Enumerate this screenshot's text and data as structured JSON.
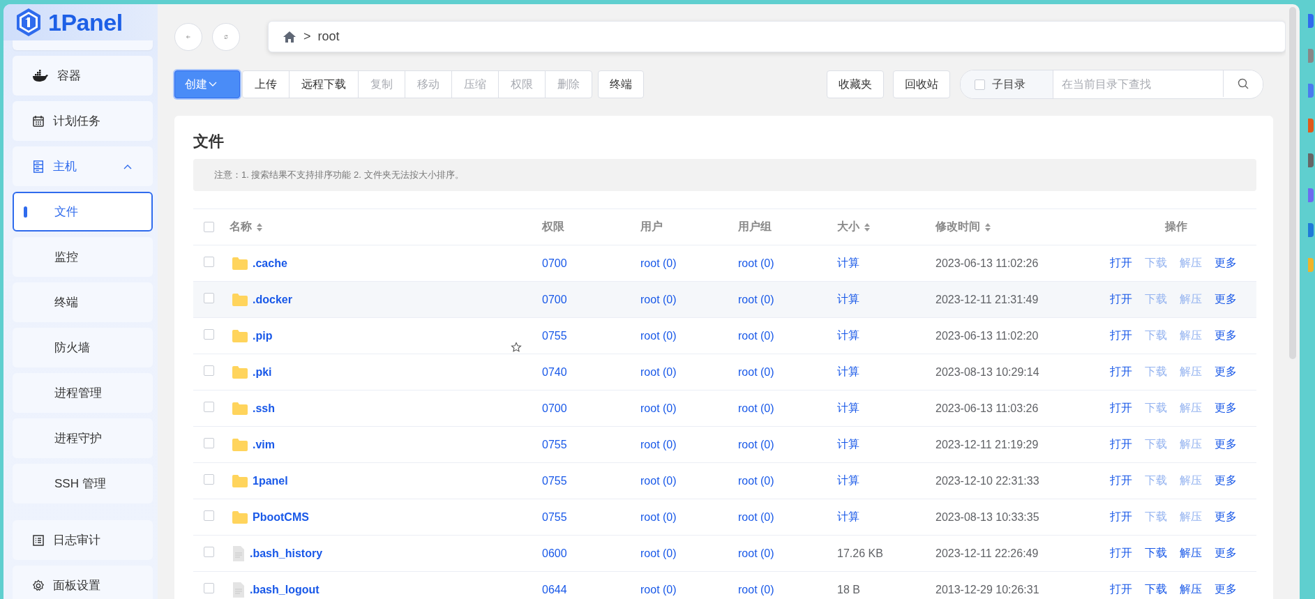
{
  "sidebar": {
    "logo": "1Panel",
    "items": [
      {
        "label": "容器",
        "selected": false
      },
      {
        "label": "计划任务",
        "selected": false
      },
      {
        "label": "主机",
        "selected": false,
        "expanded": true,
        "children": [
          {
            "label": "文件",
            "selected": true
          },
          {
            "label": "监控",
            "selected": false
          },
          {
            "label": "终端",
            "selected": false
          },
          {
            "label": "防火墙",
            "selected": false
          },
          {
            "label": "进程管理",
            "selected": false
          },
          {
            "label": "进程守护",
            "selected": false
          },
          {
            "label": "SSH 管理",
            "selected": false
          }
        ]
      },
      {
        "label": "日志审计",
        "selected": false
      },
      {
        "label": "面板设置",
        "selected": false
      }
    ]
  },
  "path": {
    "separator": ">",
    "segments": [
      "root"
    ]
  },
  "toolbar": {
    "create": {
      "label": "创建",
      "primary": true
    },
    "group": [
      {
        "label": "上传",
        "disabled": false
      },
      {
        "label": "远程下载",
        "disabled": false
      },
      {
        "label": "复制",
        "disabled": true
      },
      {
        "label": "移动",
        "disabled": true
      },
      {
        "label": "压缩",
        "disabled": true
      },
      {
        "label": "权限",
        "disabled": true
      },
      {
        "label": "删除",
        "disabled": true
      }
    ],
    "terminal": "终端",
    "right": [
      "收藏夹",
      "回收站"
    ],
    "search": {
      "subdir_label": "子目录",
      "subdir_checked": false,
      "placeholder": "在当前目录下查找"
    }
  },
  "card": {
    "title": "文件",
    "notice": "注意：1. 搜索结果不支持排序功能 2. 文件夹无法按大小排序。"
  },
  "table": {
    "all_checked": false,
    "columns": [
      {
        "label": "名称",
        "sortable": true
      },
      {
        "label": "权限",
        "sortable": false
      },
      {
        "label": "用户",
        "sortable": false
      },
      {
        "label": "用户组",
        "sortable": false
      },
      {
        "label": "大小",
        "sortable": true
      },
      {
        "label": "修改时间",
        "sortable": true
      },
      {
        "label": "操作",
        "sortable": false
      }
    ],
    "rows": [
      {
        "kind": "folder",
        "name": ".cache",
        "mode": "0700",
        "user": "root (0)",
        "group": "root (0)",
        "size": "计算",
        "modified": "2023-06-13 11:02:26",
        "checked": false,
        "hovered": false,
        "star": false,
        "actions": [
          {
            "label": "打开",
            "disabled": false
          },
          {
            "label": "下载",
            "disabled": true
          },
          {
            "label": "解压",
            "disabled": true
          },
          {
            "label": "更多",
            "disabled": false
          }
        ]
      },
      {
        "kind": "folder",
        "name": ".docker",
        "mode": "0700",
        "user": "root (0)",
        "group": "root (0)",
        "size": "计算",
        "modified": "2023-12-11 21:31:49",
        "checked": false,
        "hovered": true,
        "star": false,
        "actions": [
          {
            "label": "打开",
            "disabled": false
          },
          {
            "label": "下载",
            "disabled": true
          },
          {
            "label": "解压",
            "disabled": true
          },
          {
            "label": "更多",
            "disabled": false
          }
        ]
      },
      {
        "kind": "folder",
        "name": ".pip",
        "mode": "0755",
        "user": "root (0)",
        "group": "root (0)",
        "size": "计算",
        "modified": "2023-06-13 11:02:20",
        "checked": false,
        "hovered": false,
        "star": true,
        "actions": [
          {
            "label": "打开",
            "disabled": false
          },
          {
            "label": "下载",
            "disabled": true
          },
          {
            "label": "解压",
            "disabled": true
          },
          {
            "label": "更多",
            "disabled": false
          }
        ]
      },
      {
        "kind": "folder",
        "name": ".pki",
        "mode": "0740",
        "user": "root (0)",
        "group": "root (0)",
        "size": "计算",
        "modified": "2023-08-13 10:29:14",
        "checked": false,
        "hovered": false,
        "star": false,
        "actions": [
          {
            "label": "打开",
            "disabled": false
          },
          {
            "label": "下载",
            "disabled": true
          },
          {
            "label": "解压",
            "disabled": true
          },
          {
            "label": "更多",
            "disabled": false
          }
        ]
      },
      {
        "kind": "folder",
        "name": ".ssh",
        "mode": "0700",
        "user": "root (0)",
        "group": "root (0)",
        "size": "计算",
        "modified": "2023-06-13 11:03:26",
        "checked": false,
        "hovered": false,
        "star": false,
        "actions": [
          {
            "label": "打开",
            "disabled": false
          },
          {
            "label": "下载",
            "disabled": true
          },
          {
            "label": "解压",
            "disabled": true
          },
          {
            "label": "更多",
            "disabled": false
          }
        ]
      },
      {
        "kind": "folder",
        "name": ".vim",
        "mode": "0755",
        "user": "root (0)",
        "group": "root (0)",
        "size": "计算",
        "modified": "2023-12-11 21:19:29",
        "checked": false,
        "hovered": false,
        "star": false,
        "actions": [
          {
            "label": "打开",
            "disabled": false
          },
          {
            "label": "下载",
            "disabled": true
          },
          {
            "label": "解压",
            "disabled": true
          },
          {
            "label": "更多",
            "disabled": false
          }
        ]
      },
      {
        "kind": "folder",
        "name": "1panel",
        "mode": "0755",
        "user": "root (0)",
        "group": "root (0)",
        "size": "计算",
        "modified": "2023-12-10 22:31:33",
        "checked": false,
        "hovered": false,
        "star": false,
        "actions": [
          {
            "label": "打开",
            "disabled": false
          },
          {
            "label": "下载",
            "disabled": true
          },
          {
            "label": "解压",
            "disabled": true
          },
          {
            "label": "更多",
            "disabled": false
          }
        ]
      },
      {
        "kind": "folder",
        "name": "PbootCMS",
        "mode": "0755",
        "user": "root (0)",
        "group": "root (0)",
        "size": "计算",
        "modified": "2023-08-13 10:33:35",
        "checked": false,
        "hovered": false,
        "star": false,
        "actions": [
          {
            "label": "打开",
            "disabled": false
          },
          {
            "label": "下载",
            "disabled": true
          },
          {
            "label": "解压",
            "disabled": true
          },
          {
            "label": "更多",
            "disabled": false
          }
        ]
      },
      {
        "kind": "file",
        "name": ".bash_history",
        "mode": "0600",
        "user": "root (0)",
        "group": "root (0)",
        "size": "17.26 KB",
        "modified": "2023-12-11 22:26:49",
        "checked": false,
        "hovered": false,
        "star": false,
        "actions": [
          {
            "label": "打开",
            "disabled": false
          },
          {
            "label": "下载",
            "disabled": false
          },
          {
            "label": "解压",
            "disabled": false
          },
          {
            "label": "更多",
            "disabled": false
          }
        ]
      },
      {
        "kind": "file",
        "name": ".bash_logout",
        "mode": "0644",
        "user": "root (0)",
        "group": "root (0)",
        "size": "18 B",
        "modified": "2013-12-29 10:26:31",
        "checked": false,
        "hovered": false,
        "star": false,
        "actions": [
          {
            "label": "打开",
            "disabled": false
          },
          {
            "label": "下载",
            "disabled": false
          },
          {
            "label": "解压",
            "disabled": false
          },
          {
            "label": "更多",
            "disabled": false
          }
        ]
      }
    ]
  }
}
